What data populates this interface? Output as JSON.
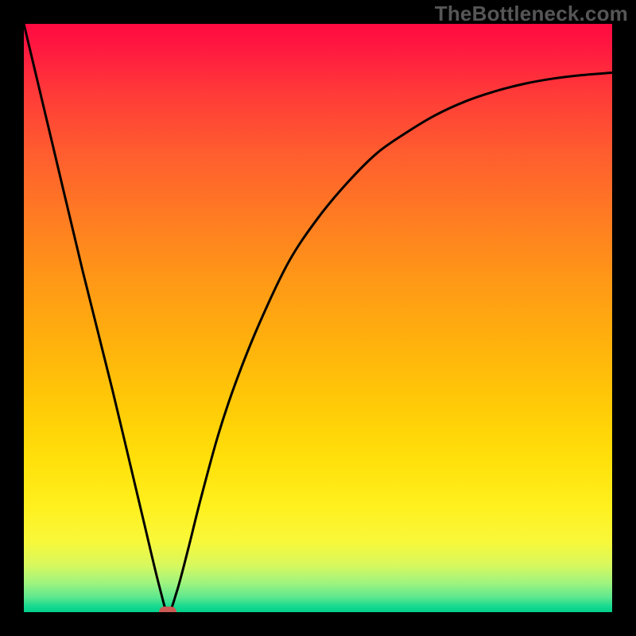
{
  "watermark": "TheBottleneck.com",
  "chart_data": {
    "type": "line",
    "title": "",
    "xlabel": "",
    "ylabel": "",
    "xlim": [
      0,
      100
    ],
    "ylim": [
      0,
      100
    ],
    "series": [
      {
        "name": "curve",
        "x": [
          0,
          5,
          10,
          15,
          20,
          23,
          24.5,
          26,
          28,
          30,
          33,
          36,
          40,
          45,
          50,
          55,
          60,
          65,
          70,
          75,
          80,
          85,
          90,
          95,
          100
        ],
        "y": [
          100,
          79,
          58,
          38,
          17,
          4.5,
          0,
          3.5,
          11,
          19,
          30,
          39,
          49,
          59.5,
          67,
          73,
          78,
          81.5,
          84.5,
          86.8,
          88.5,
          89.8,
          90.7,
          91.3,
          91.7
        ]
      }
    ],
    "marker": {
      "x": 24.5,
      "y": 0
    },
    "gradient_stops": [
      {
        "pos": 0,
        "color": "#ff0a41"
      },
      {
        "pos": 50,
        "color": "#ffb30c"
      },
      {
        "pos": 88,
        "color": "#f8f83a"
      },
      {
        "pos": 100,
        "color": "#00d08a"
      }
    ]
  }
}
